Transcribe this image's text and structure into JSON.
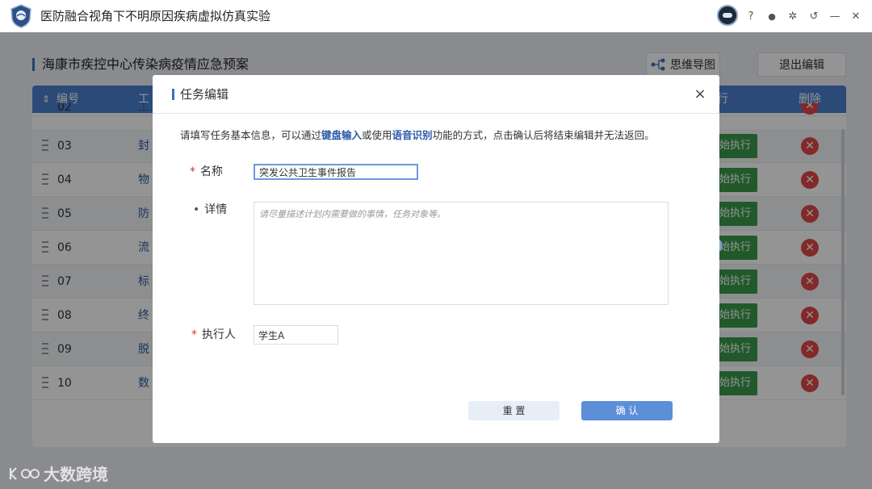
{
  "app": {
    "title": "医防融合视角下不明原因疾病虚拟仿真实验",
    "controls": [
      "?",
      "person-icon",
      "gear-icon",
      "undo-icon",
      "minimize-icon",
      "close-icon"
    ],
    "control_glyphs": {
      "help": "?",
      "user": "●",
      "settings": "✲",
      "back": "↺",
      "minimize": "—",
      "close": "✕"
    }
  },
  "page": {
    "title": "海康市疾控中心传染病疫情应急预案",
    "mindmap_button": "思维导图",
    "exit_button": "退出编辑",
    "table": {
      "headers": {
        "number": "编号",
        "work": "工",
        "exec": "行",
        "delete": "删除"
      },
      "rows": [
        {
          "num": "02",
          "name": "工"
        },
        {
          "num": "03",
          "name": "封"
        },
        {
          "num": "04",
          "name": "物"
        },
        {
          "num": "05",
          "name": "防"
        },
        {
          "num": "06",
          "name": "流"
        },
        {
          "num": "07",
          "name": "标"
        },
        {
          "num": "08",
          "name": "终"
        },
        {
          "num": "09",
          "name": "脱"
        },
        {
          "num": "10",
          "name": "数"
        }
      ],
      "exec_label": "始执行"
    }
  },
  "dialog": {
    "title": "任务编辑",
    "close": "×",
    "desc_before": "请填写任务基本信息，可以通过",
    "desc_link1": "键盘输入",
    "desc_middle": "或使用",
    "desc_link2": "语音识别",
    "desc_after": "功能的方式，点击确认后将结束编辑并无法返回。",
    "name_label": "名称",
    "name_value": "突发公共卫生事件报告",
    "detail_label": "详情",
    "detail_placeholder": "请尽量描述计划内需要做的事情，任务对象等。",
    "executor_label": "执行人",
    "executor_value": "学生A",
    "reset_button": "重 置",
    "confirm_button": "确 认"
  },
  "watermark": "大数跨境"
}
